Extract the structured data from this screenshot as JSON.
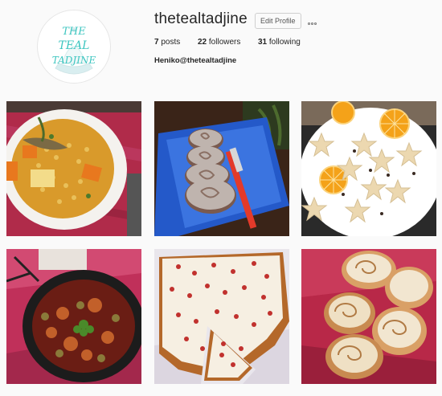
{
  "profile": {
    "username": "thetealtadjine",
    "edit_profile_label": "Edit Profile",
    "more_options_icon": "more-options-icon",
    "bio": "Heniko@thetealtadjine",
    "stats": {
      "posts_count": "7",
      "posts_label": "posts",
      "followers_count": "22",
      "followers_label": "followers",
      "following_count": "31",
      "following_label": "following"
    },
    "avatar": {
      "logo_text_line1": "THE",
      "logo_text_line2": "TEAL",
      "logo_text_line3": "TADJINE",
      "logo_color": "#3ec6c0"
    }
  },
  "posts": [
    {
      "subject": "soup-bowl"
    },
    {
      "subject": "heart-bread"
    },
    {
      "subject": "star-cookies-oranges"
    },
    {
      "subject": "stew-pan"
    },
    {
      "subject": "pomegranate-cake"
    },
    {
      "subject": "cinnamon-rolls"
    }
  ],
  "colors": {
    "background": "#fafafa",
    "text": "#262626",
    "accent_teal": "#3ec6c0"
  }
}
